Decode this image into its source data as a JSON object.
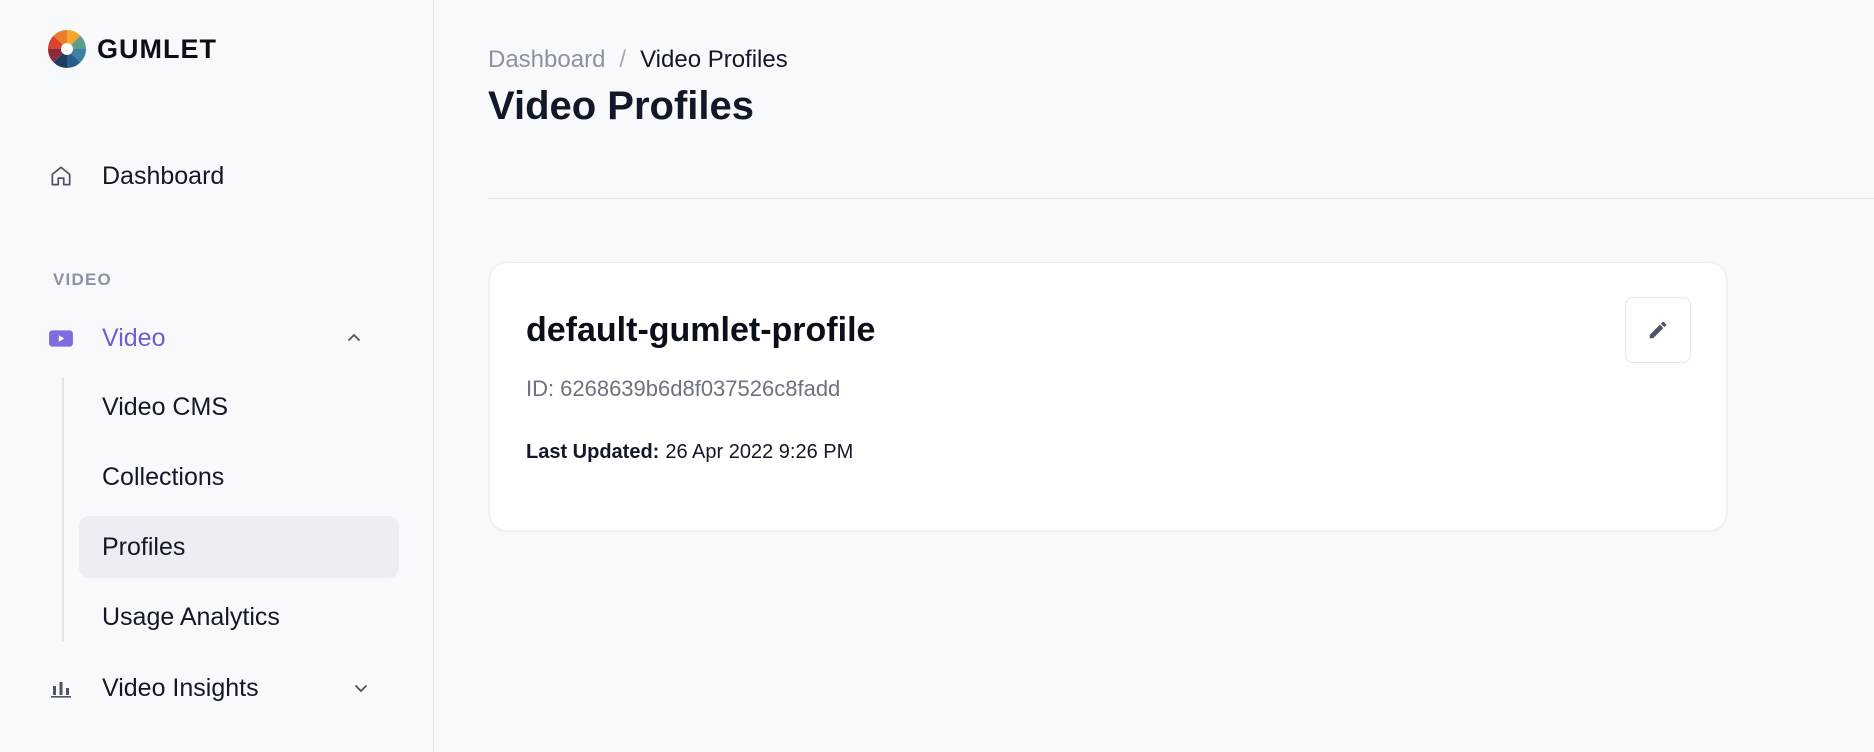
{
  "brand": {
    "name": "GUMLET"
  },
  "sidebar": {
    "dashboard_label": "Dashboard",
    "section_title": "VIDEO",
    "video_label": "Video",
    "video_submenu": [
      {
        "label": "Video CMS"
      },
      {
        "label": "Collections"
      },
      {
        "label": "Profiles",
        "active": true
      },
      {
        "label": "Usage Analytics"
      }
    ],
    "insights_label": "Video Insights"
  },
  "breadcrumb": {
    "parent": "Dashboard",
    "separator": "/",
    "current": "Video Profiles"
  },
  "page": {
    "title": "Video Profiles"
  },
  "profile_card": {
    "name": "default-gumlet-profile",
    "id_label": "ID:",
    "id_value": "6268639b6d8f037526c8fadd",
    "updated_label": "Last Updated:",
    "updated_value": "26 Apr 2022 9:26 PM"
  },
  "icons": {
    "home": "home-icon",
    "video": "video-icon",
    "chevron_up": "chevron-up-icon",
    "chevron_down": "chevron-down-icon",
    "insights": "bar-chart-icon",
    "edit": "pencil-icon"
  },
  "colors": {
    "accent": "#6c5fd6",
    "active_bg": "#eceef3",
    "muted_text": "#8a93a3"
  }
}
